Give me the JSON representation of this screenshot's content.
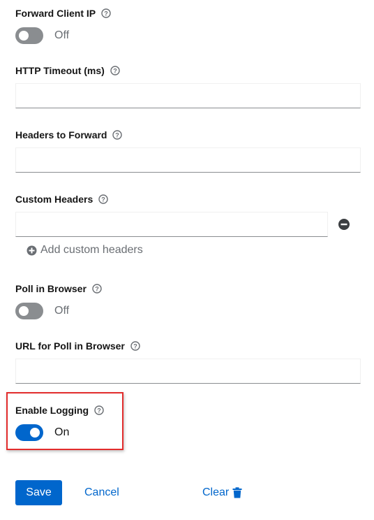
{
  "fields": {
    "forward_client_ip": {
      "label": "Forward Client IP",
      "state": "Off"
    },
    "http_timeout": {
      "label": "HTTP Timeout (ms)",
      "value": ""
    },
    "headers_to_forward": {
      "label": "Headers to Forward",
      "value": ""
    },
    "custom_headers": {
      "label": "Custom Headers",
      "value": "",
      "add_label": "Add custom headers"
    },
    "poll_in_browser": {
      "label": "Poll in Browser",
      "state": "Off"
    },
    "url_poll_browser": {
      "label": "URL for Poll in Browser",
      "value": ""
    },
    "enable_logging": {
      "label": "Enable Logging",
      "state": "On"
    }
  },
  "actions": {
    "save": "Save",
    "cancel": "Cancel",
    "clear": "Clear"
  },
  "icons": {
    "help": "question-circle-icon",
    "remove": "minus-circle-icon",
    "add": "plus-circle-icon",
    "trash": "trash-icon"
  },
  "colors": {
    "primary": "#0066cc",
    "switch_off": "#8a8d90",
    "highlight": "#e22c2c"
  }
}
